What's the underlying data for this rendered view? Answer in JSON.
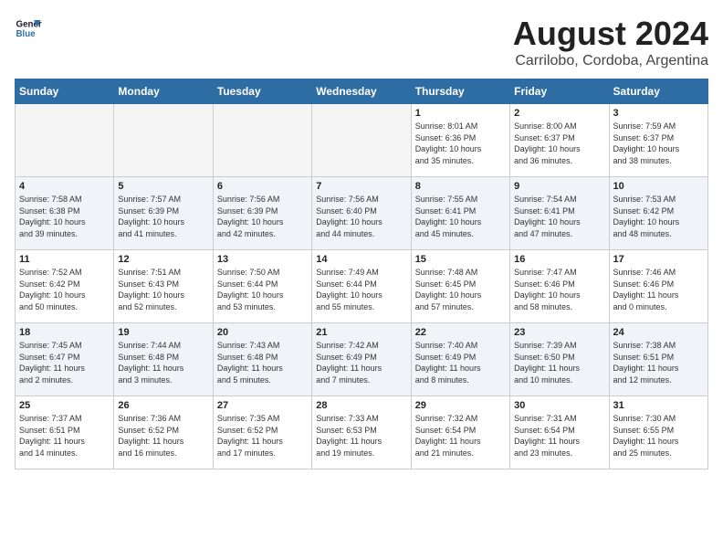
{
  "logo": {
    "line1": "General",
    "line2": "Blue"
  },
  "title": "August 2024",
  "subtitle": "Carrilobo, Cordoba, Argentina",
  "days_of_week": [
    "Sunday",
    "Monday",
    "Tuesday",
    "Wednesday",
    "Thursday",
    "Friday",
    "Saturday"
  ],
  "weeks": [
    [
      {
        "day": "",
        "info": ""
      },
      {
        "day": "",
        "info": ""
      },
      {
        "day": "",
        "info": ""
      },
      {
        "day": "",
        "info": ""
      },
      {
        "day": "1",
        "info": "Sunrise: 8:01 AM\nSunset: 6:36 PM\nDaylight: 10 hours\nand 35 minutes."
      },
      {
        "day": "2",
        "info": "Sunrise: 8:00 AM\nSunset: 6:37 PM\nDaylight: 10 hours\nand 36 minutes."
      },
      {
        "day": "3",
        "info": "Sunrise: 7:59 AM\nSunset: 6:37 PM\nDaylight: 10 hours\nand 38 minutes."
      }
    ],
    [
      {
        "day": "4",
        "info": "Sunrise: 7:58 AM\nSunset: 6:38 PM\nDaylight: 10 hours\nand 39 minutes."
      },
      {
        "day": "5",
        "info": "Sunrise: 7:57 AM\nSunset: 6:39 PM\nDaylight: 10 hours\nand 41 minutes."
      },
      {
        "day": "6",
        "info": "Sunrise: 7:56 AM\nSunset: 6:39 PM\nDaylight: 10 hours\nand 42 minutes."
      },
      {
        "day": "7",
        "info": "Sunrise: 7:56 AM\nSunset: 6:40 PM\nDaylight: 10 hours\nand 44 minutes."
      },
      {
        "day": "8",
        "info": "Sunrise: 7:55 AM\nSunset: 6:41 PM\nDaylight: 10 hours\nand 45 minutes."
      },
      {
        "day": "9",
        "info": "Sunrise: 7:54 AM\nSunset: 6:41 PM\nDaylight: 10 hours\nand 47 minutes."
      },
      {
        "day": "10",
        "info": "Sunrise: 7:53 AM\nSunset: 6:42 PM\nDaylight: 10 hours\nand 48 minutes."
      }
    ],
    [
      {
        "day": "11",
        "info": "Sunrise: 7:52 AM\nSunset: 6:42 PM\nDaylight: 10 hours\nand 50 minutes."
      },
      {
        "day": "12",
        "info": "Sunrise: 7:51 AM\nSunset: 6:43 PM\nDaylight: 10 hours\nand 52 minutes."
      },
      {
        "day": "13",
        "info": "Sunrise: 7:50 AM\nSunset: 6:44 PM\nDaylight: 10 hours\nand 53 minutes."
      },
      {
        "day": "14",
        "info": "Sunrise: 7:49 AM\nSunset: 6:44 PM\nDaylight: 10 hours\nand 55 minutes."
      },
      {
        "day": "15",
        "info": "Sunrise: 7:48 AM\nSunset: 6:45 PM\nDaylight: 10 hours\nand 57 minutes."
      },
      {
        "day": "16",
        "info": "Sunrise: 7:47 AM\nSunset: 6:46 PM\nDaylight: 10 hours\nand 58 minutes."
      },
      {
        "day": "17",
        "info": "Sunrise: 7:46 AM\nSunset: 6:46 PM\nDaylight: 11 hours\nand 0 minutes."
      }
    ],
    [
      {
        "day": "18",
        "info": "Sunrise: 7:45 AM\nSunset: 6:47 PM\nDaylight: 11 hours\nand 2 minutes."
      },
      {
        "day": "19",
        "info": "Sunrise: 7:44 AM\nSunset: 6:48 PM\nDaylight: 11 hours\nand 3 minutes."
      },
      {
        "day": "20",
        "info": "Sunrise: 7:43 AM\nSunset: 6:48 PM\nDaylight: 11 hours\nand 5 minutes."
      },
      {
        "day": "21",
        "info": "Sunrise: 7:42 AM\nSunset: 6:49 PM\nDaylight: 11 hours\nand 7 minutes."
      },
      {
        "day": "22",
        "info": "Sunrise: 7:40 AM\nSunset: 6:49 PM\nDaylight: 11 hours\nand 8 minutes."
      },
      {
        "day": "23",
        "info": "Sunrise: 7:39 AM\nSunset: 6:50 PM\nDaylight: 11 hours\nand 10 minutes."
      },
      {
        "day": "24",
        "info": "Sunrise: 7:38 AM\nSunset: 6:51 PM\nDaylight: 11 hours\nand 12 minutes."
      }
    ],
    [
      {
        "day": "25",
        "info": "Sunrise: 7:37 AM\nSunset: 6:51 PM\nDaylight: 11 hours\nand 14 minutes."
      },
      {
        "day": "26",
        "info": "Sunrise: 7:36 AM\nSunset: 6:52 PM\nDaylight: 11 hours\nand 16 minutes."
      },
      {
        "day": "27",
        "info": "Sunrise: 7:35 AM\nSunset: 6:52 PM\nDaylight: 11 hours\nand 17 minutes."
      },
      {
        "day": "28",
        "info": "Sunrise: 7:33 AM\nSunset: 6:53 PM\nDaylight: 11 hours\nand 19 minutes."
      },
      {
        "day": "29",
        "info": "Sunrise: 7:32 AM\nSunset: 6:54 PM\nDaylight: 11 hours\nand 21 minutes."
      },
      {
        "day": "30",
        "info": "Sunrise: 7:31 AM\nSunset: 6:54 PM\nDaylight: 11 hours\nand 23 minutes."
      },
      {
        "day": "31",
        "info": "Sunrise: 7:30 AM\nSunset: 6:55 PM\nDaylight: 11 hours\nand 25 minutes."
      }
    ]
  ]
}
